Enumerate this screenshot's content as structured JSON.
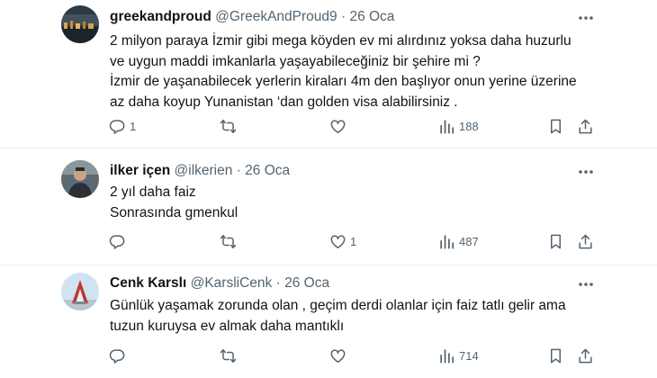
{
  "tweets": [
    {
      "name": "greekandproud",
      "handle": "@GreekAndProud9",
      "separator": "·",
      "date": "26 Oca",
      "lines": [
        "2 milyon paraya İzmir gibi mega köyden ev mi alırdınız yoksa daha huzurlu",
        "ve uygun maddi imkanlarla yaşayabileceğiniz bir şehire mi ?",
        "İzmir de yaşanabilecek yerlerin kiraları 4m den başlıyor onun yerine üzerine",
        "az daha koyup Yunanistan ‘dan golden visa alabilirsiniz ."
      ],
      "reply_count": "1",
      "retweet_count": "",
      "like_count": "",
      "view_count": "188"
    },
    {
      "name": "ilker içen",
      "handle": "@ilkerien",
      "separator": "·",
      "date": "26 Oca",
      "lines": [
        "2 yıl daha faiz",
        "Sonrasında gmenkul"
      ],
      "reply_count": "",
      "retweet_count": "",
      "like_count": "1",
      "view_count": "487"
    },
    {
      "name": "Cenk Karslı",
      "handle": "@KarsliCenk",
      "separator": "·",
      "date": "26 Oca",
      "lines": [
        "Günlük yaşamak zorunda olan , geçim derdi olanlar için faiz tatlı gelir ama",
        "tuzun kuruysa ev almak daha mantıklı"
      ],
      "reply_count": "",
      "retweet_count": "",
      "like_count": "",
      "view_count": "714"
    }
  ],
  "colors": {
    "text": "#0f1419",
    "secondary": "#536471",
    "divider": "#e6ecf0"
  },
  "icons": [
    "more-icon",
    "reply-icon",
    "retweet-icon",
    "like-icon",
    "views-icon",
    "bookmark-icon",
    "share-icon"
  ]
}
